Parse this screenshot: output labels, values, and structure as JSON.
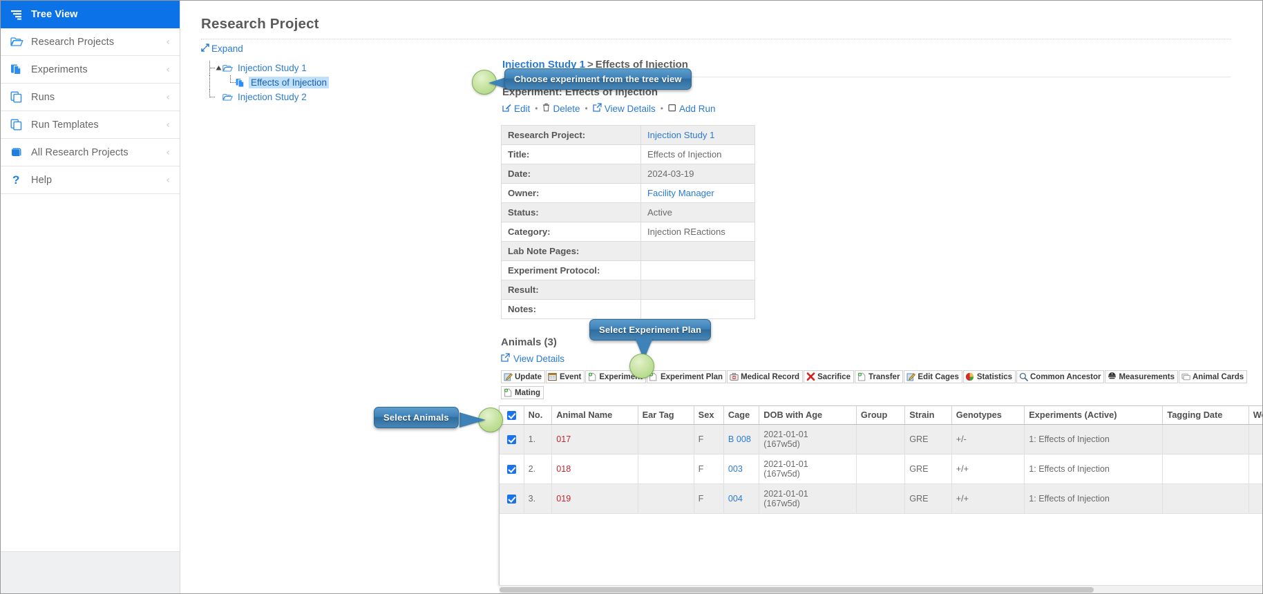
{
  "sidebar": {
    "items": [
      {
        "label": "Tree View",
        "icon": "tree-view-icon",
        "active": true,
        "chevron": false
      },
      {
        "label": "Research Projects",
        "icon": "open-folder-icon",
        "active": false,
        "chevron": true
      },
      {
        "label": "Experiments",
        "icon": "documents-blue-icon",
        "active": false,
        "chevron": true
      },
      {
        "label": "Runs",
        "icon": "copy-pages-icon",
        "active": false,
        "chevron": true
      },
      {
        "label": "Run Templates",
        "icon": "copy-pages-icon",
        "active": false,
        "chevron": true
      },
      {
        "label": "All Research Projects",
        "icon": "book-icon",
        "active": false,
        "chevron": true
      },
      {
        "label": "Help",
        "icon": "question-mark-icon",
        "active": false,
        "chevron": true
      }
    ],
    "chevron_glyph": "‹"
  },
  "main": {
    "page_title": "Research Project",
    "expand_label": "Expand",
    "tree": [
      {
        "label": "Injection Study 1",
        "icon": "open-folder-icon",
        "level": 0,
        "selected": false,
        "toggle": true
      },
      {
        "label": "Effects of Injection",
        "icon": "experiment-icon",
        "level": 1,
        "selected": true,
        "toggle": false
      },
      {
        "label": "Injection Study 2",
        "icon": "open-folder-icon",
        "level": 0,
        "selected": false,
        "toggle": false
      }
    ],
    "breadcrumb": {
      "root": "Injection Study 1",
      "separator": ">",
      "current": "Effects of Injection"
    },
    "experiment_heading": "Experiment: Effects of Injection",
    "actions": [
      {
        "label": "Edit",
        "icon": "pencil-edit-icon"
      },
      {
        "label": "Delete",
        "icon": "trash-icon"
      },
      {
        "label": "View Details",
        "icon": "external-link-icon"
      },
      {
        "label": "Add Run",
        "icon": "square-outline-icon"
      }
    ],
    "action_separator": "•",
    "details": [
      {
        "key": "Research Project:",
        "value": "Injection Study 1",
        "link": true
      },
      {
        "key": "Title:",
        "value": "Effects of Injection",
        "link": false
      },
      {
        "key": "Date:",
        "value": "2024-03-19",
        "link": false
      },
      {
        "key": "Owner:",
        "value": "Facility Manager",
        "link": true
      },
      {
        "key": "Status:",
        "value": "Active",
        "link": false
      },
      {
        "key": "Category:",
        "value": "Injection REactions",
        "link": false
      },
      {
        "key": "Lab Note Pages:",
        "value": "",
        "link": false
      },
      {
        "key": "Experiment Protocol:",
        "value": "",
        "link": false
      },
      {
        "key": "Result:",
        "value": "",
        "link": false
      },
      {
        "key": "Notes:",
        "value": "",
        "link": false
      }
    ],
    "animals": {
      "title": "Animals (3)",
      "view_details_label": "View Details",
      "toolbar": [
        {
          "label": "Update",
          "icon": "pencil-pad-icon"
        },
        {
          "label": "Event",
          "icon": "calendar-icon"
        },
        {
          "label": "Experiment",
          "icon": "page-plus-green-icon"
        },
        {
          "label": "Experiment Plan",
          "icon": "page-plus-green-icon"
        },
        {
          "label": "Medical Record",
          "icon": "first-aid-kit-icon"
        },
        {
          "label": "Sacrifice",
          "icon": "red-x-icon"
        },
        {
          "label": "Transfer",
          "icon": "page-plus-green-icon"
        },
        {
          "label": "Edit Cages",
          "icon": "pencil-pad-icon"
        },
        {
          "label": "Statistics",
          "icon": "pie-chart-icon"
        },
        {
          "label": "Common Ancestor",
          "icon": "magnifier-icon"
        },
        {
          "label": "Measurements",
          "icon": "scale-icon"
        },
        {
          "label": "Animal Cards",
          "icon": "cards-icon"
        },
        {
          "label": "Mating",
          "icon": "page-plus-green-icon"
        }
      ],
      "columns": [
        "No.",
        "Animal Name",
        "Ear Tag",
        "Sex",
        "Cage",
        "DOB with Age",
        "Group",
        "Strain",
        "Genotypes",
        "Experiments (Active)",
        "Tagging Date",
        "Weaning Date"
      ],
      "rows": [
        {
          "checked": true,
          "no": "1.",
          "animal_name": "017",
          "ear_tag": "",
          "sex": "F",
          "cage": "B 008",
          "dob": "2021-01-01",
          "age": "(167w5d)",
          "group": "",
          "strain": "GRE",
          "genotypes": "+/-",
          "experiments": "1: Effects of Injection",
          "tagging_date": "",
          "weaning_date": ""
        },
        {
          "checked": true,
          "no": "2.",
          "animal_name": "018",
          "ear_tag": "",
          "sex": "F",
          "cage": "003",
          "dob": "2021-01-01",
          "age": "(167w5d)",
          "group": "",
          "strain": "GRE",
          "genotypes": "+/+",
          "experiments": "1: Effects of Injection",
          "tagging_date": "",
          "weaning_date": ""
        },
        {
          "checked": true,
          "no": "3.",
          "animal_name": "019",
          "ear_tag": "",
          "sex": "F",
          "cage": "004",
          "dob": "2021-01-01",
          "age": "(167w5d)",
          "group": "",
          "strain": "GRE",
          "genotypes": "+/+",
          "experiments": "1: Effects of Injection",
          "tagging_date": "",
          "weaning_date": ""
        }
      ]
    }
  },
  "callouts": {
    "tree": "Choose experiment from the tree view",
    "animals": "Select Animals",
    "plan": "Select Experiment Plan"
  },
  "colors": {
    "accent_blue": "#0b72e7",
    "link_blue": "#2a7ad4",
    "callout_blue": "#3f82b8",
    "callout_dot_green": "#c2e09a",
    "animal_name_red": "#c0272d",
    "selected_tree_bg": "#bfe0fb"
  }
}
